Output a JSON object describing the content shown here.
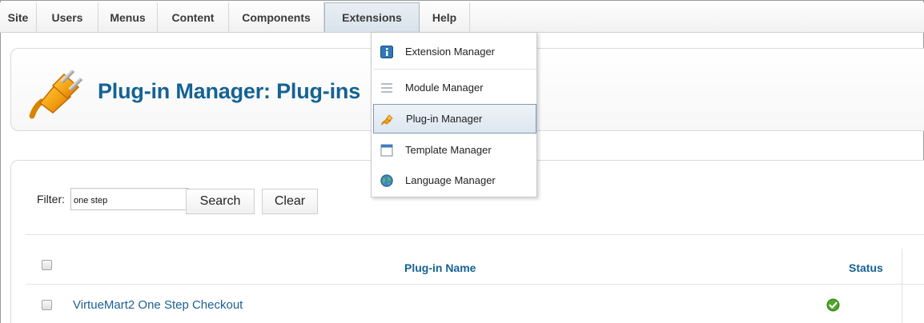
{
  "menubar": {
    "items": [
      {
        "label": "Site"
      },
      {
        "label": "Users"
      },
      {
        "label": "Menus"
      },
      {
        "label": "Content"
      },
      {
        "label": "Components"
      },
      {
        "label": "Extensions"
      },
      {
        "label": "Help"
      }
    ]
  },
  "header": {
    "title": "Plug-in Manager: Plug-ins",
    "logo_icon": "plug-icon"
  },
  "dropdown": {
    "items": [
      {
        "label": "Extension Manager",
        "icon": "extension-manager-icon"
      },
      {
        "label": "Module Manager",
        "icon": "module-manager-icon"
      },
      {
        "label": "Plug-in Manager",
        "icon": "plugin-manager-icon"
      },
      {
        "label": "Template Manager",
        "icon": "template-manager-icon"
      },
      {
        "label": "Language Manager",
        "icon": "language-manager-icon"
      }
    ]
  },
  "filter": {
    "label": "Filter:",
    "value": "one step",
    "search_label": "Search",
    "clear_label": "Clear"
  },
  "table": {
    "columns": {
      "name": "Plug-in Name",
      "status": "Status"
    },
    "rows": [
      {
        "name": "VirtueMart2 One Step Checkout",
        "status_icon": "enabled-check-icon"
      }
    ]
  },
  "colors": {
    "title_blue": "#146295",
    "link_blue": "#1c5f93",
    "status_green": "#3a8a1e"
  }
}
